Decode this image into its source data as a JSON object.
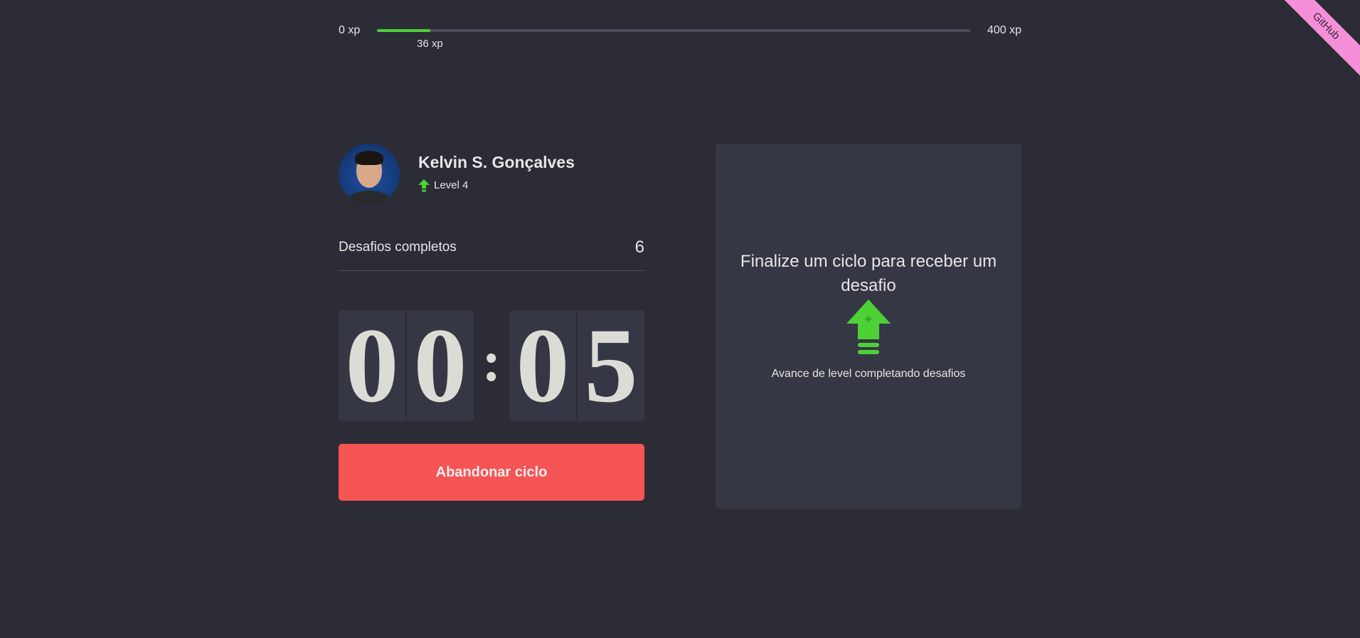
{
  "xp": {
    "min_label": "0 xp",
    "max_label": "400 xp",
    "current_label": "36 xp",
    "current": 36,
    "max": 400
  },
  "ribbon": {
    "label": "GitHub"
  },
  "profile": {
    "name": "Kelvin S. Gonçalves",
    "level_label": "Level 4"
  },
  "challenges": {
    "label": "Desafios completos",
    "count": "6"
  },
  "countdown": {
    "minutes": [
      "0",
      "0"
    ],
    "seconds": [
      "0",
      "5"
    ],
    "separator": ":"
  },
  "actions": {
    "abandon_label": "Abandonar ciclo"
  },
  "challenge_box": {
    "title": "Finalize um ciclo para receber um desafio",
    "subtitle": "Avance de level completando desafios"
  },
  "colors": {
    "background": "#2b2c35",
    "panel": "#363744",
    "accent_green": "#4cd137",
    "danger": "#f55555",
    "ribbon": "#f78fd8"
  },
  "icons": {
    "level": "level-up-arrow-icon",
    "challenge": "level-up-arrow-icon"
  }
}
